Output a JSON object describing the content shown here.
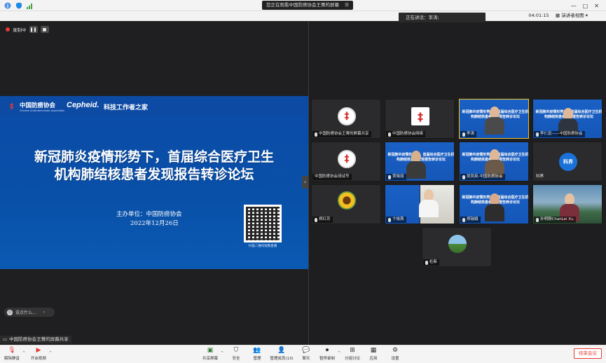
{
  "topbar": {
    "sharing_notice": "您正在观看中国防痨协会王菁的屏幕",
    "window_controls": [
      "—",
      "□",
      "✕"
    ]
  },
  "subbar": {
    "speaker_label": "正在讲话：李涛;",
    "timer": "04:01:15",
    "layout_button": "演讲者视图"
  },
  "recording": {
    "label": "录制中",
    "pause": "❚❚",
    "stop": "■"
  },
  "slide": {
    "org_cn": "中国防痨协会",
    "org_en": "Chinese Antituberculosis Association",
    "brand2": "Cepheid.",
    "brand3": "科技工作者之家",
    "title_line1": "新冠肺炎疫情形势下，首届综合医疗卫生",
    "title_line2": "机构肺结核患者发现报告转诊论坛",
    "host_line": "主办单位：中国防痨协会",
    "date_line": "2022年12月26日",
    "qr_caption": "扫描二维码观看直播"
  },
  "chat": {
    "placeholder": "说点什么..."
  },
  "share_label": "中国防痨协会王菁的屏幕共享",
  "tiles": [
    {
      "name": "中国防痨协会王菁的屏幕共享",
      "kind": "round-logo"
    },
    {
      "name": "中国防痨协会网络",
      "kind": "square-logo"
    },
    {
      "name": "李涛",
      "kind": "slide-person"
    },
    {
      "name": "李仁忠——中国防痨协会",
      "kind": "slide-person"
    },
    {
      "name": "中国防痨协会测试号",
      "kind": "round-logo"
    },
    {
      "name": "贾晓丽",
      "kind": "slide-person"
    },
    {
      "name": "吴凤英-中国防痨协会",
      "kind": "slide-person"
    },
    {
      "name": "科界",
      "kind": "blue-avatar",
      "avatar_text": "科界"
    },
    {
      "name": "郑红芳",
      "kind": "flower"
    },
    {
      "name": "卞晓燕",
      "kind": "room-person"
    },
    {
      "name": "郑瑞娟",
      "kind": "slide-person"
    },
    {
      "name": "孙明刚ChanLei Xu",
      "kind": "scenery-person"
    },
    {
      "name": "杜新",
      "kind": "landscape"
    }
  ],
  "tile_slide_text": "新冠肺炎疫情形势下，首届综合医疗卫生机构肺结核患者发现报告转诊论坛",
  "toolbar": {
    "mute": "解除静音",
    "video": "开启视频",
    "share": "共享屏幕",
    "security": "安全",
    "participants": "管理",
    "members": "管理成员(13)",
    "chat": "聊天",
    "record": "暂停录制",
    "breakout": "分组讨论",
    "apps": "应用",
    "settings": "设置",
    "end": "结束会议"
  },
  "colors": {
    "accent_red": "#e53935",
    "slide_blue": "#0a4ba8",
    "active_border": "#f0c020"
  }
}
